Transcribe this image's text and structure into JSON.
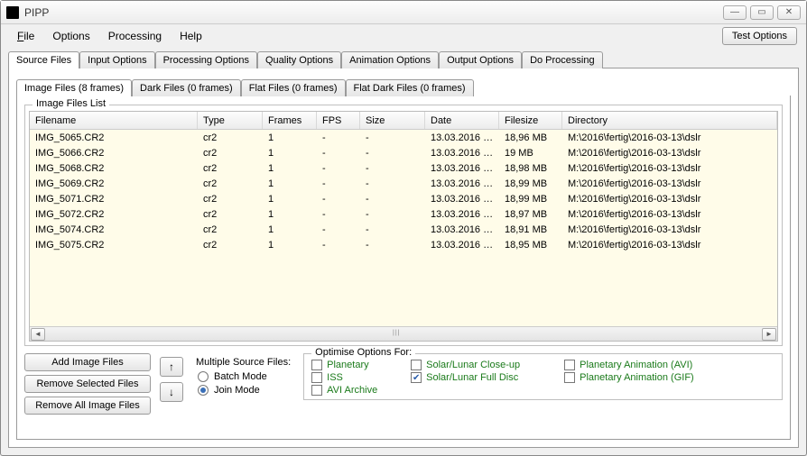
{
  "title": "PIPP",
  "menu": {
    "file": "File",
    "options": "Options",
    "processing": "Processing",
    "help": "Help",
    "test": "Test Options"
  },
  "topTabs": [
    "Source Files",
    "Input Options",
    "Processing Options",
    "Quality Options",
    "Animation Options",
    "Output Options",
    "Do Processing"
  ],
  "subTabs": [
    "Image Files (8 frames)",
    "Dark Files (0 frames)",
    "Flat Files (0 frames)",
    "Flat Dark Files (0 frames)"
  ],
  "listTitle": "Image Files List",
  "columns": {
    "filename": "Filename",
    "type": "Type",
    "frames": "Frames",
    "fps": "FPS",
    "size": "Size",
    "date": "Date",
    "filesize": "Filesize",
    "directory": "Directory"
  },
  "rows": [
    {
      "fn": "IMG_5065.CR2",
      "ty": "cr2",
      "fr": "1",
      "fp": "-",
      "sz": "-",
      "dt": "13.03.2016 1...",
      "fs": "18,96 MB",
      "dir": "M:\\2016\\fertig\\2016-03-13\\dslr"
    },
    {
      "fn": "IMG_5066.CR2",
      "ty": "cr2",
      "fr": "1",
      "fp": "-",
      "sz": "-",
      "dt": "13.03.2016 1...",
      "fs": "19 MB",
      "dir": "M:\\2016\\fertig\\2016-03-13\\dslr"
    },
    {
      "fn": "IMG_5068.CR2",
      "ty": "cr2",
      "fr": "1",
      "fp": "-",
      "sz": "-",
      "dt": "13.03.2016 1...",
      "fs": "18,98 MB",
      "dir": "M:\\2016\\fertig\\2016-03-13\\dslr"
    },
    {
      "fn": "IMG_5069.CR2",
      "ty": "cr2",
      "fr": "1",
      "fp": "-",
      "sz": "-",
      "dt": "13.03.2016 1...",
      "fs": "18,99 MB",
      "dir": "M:\\2016\\fertig\\2016-03-13\\dslr"
    },
    {
      "fn": "IMG_5071.CR2",
      "ty": "cr2",
      "fr": "1",
      "fp": "-",
      "sz": "-",
      "dt": "13.03.2016 1...",
      "fs": "18,99 MB",
      "dir": "M:\\2016\\fertig\\2016-03-13\\dslr"
    },
    {
      "fn": "IMG_5072.CR2",
      "ty": "cr2",
      "fr": "1",
      "fp": "-",
      "sz": "-",
      "dt": "13.03.2016 1...",
      "fs": "18,97 MB",
      "dir": "M:\\2016\\fertig\\2016-03-13\\dslr"
    },
    {
      "fn": "IMG_5074.CR2",
      "ty": "cr2",
      "fr": "1",
      "fp": "-",
      "sz": "-",
      "dt": "13.03.2016 1...",
      "fs": "18,91 MB",
      "dir": "M:\\2016\\fertig\\2016-03-13\\dslr"
    },
    {
      "fn": "IMG_5075.CR2",
      "ty": "cr2",
      "fr": "1",
      "fp": "-",
      "sz": "-",
      "dt": "13.03.2016 1...",
      "fs": "18,95 MB",
      "dir": "M:\\2016\\fertig\\2016-03-13\\dslr"
    }
  ],
  "buttons": {
    "add": "Add Image Files",
    "removeSel": "Remove Selected Files",
    "removeAll": "Remove All Image Files"
  },
  "modes": {
    "title": "Multiple Source Files:",
    "batch": "Batch Mode",
    "join": "Join Mode"
  },
  "opt": {
    "title": "Optimise Options For:",
    "planetary": "Planetary",
    "iss": "ISS",
    "avi": "AVI Archive",
    "closeup": "Solar/Lunar Close-up",
    "fulldisc": "Solar/Lunar Full Disc",
    "animAvi": "Planetary Animation (AVI)",
    "animGif": "Planetary Animation (GIF)"
  }
}
